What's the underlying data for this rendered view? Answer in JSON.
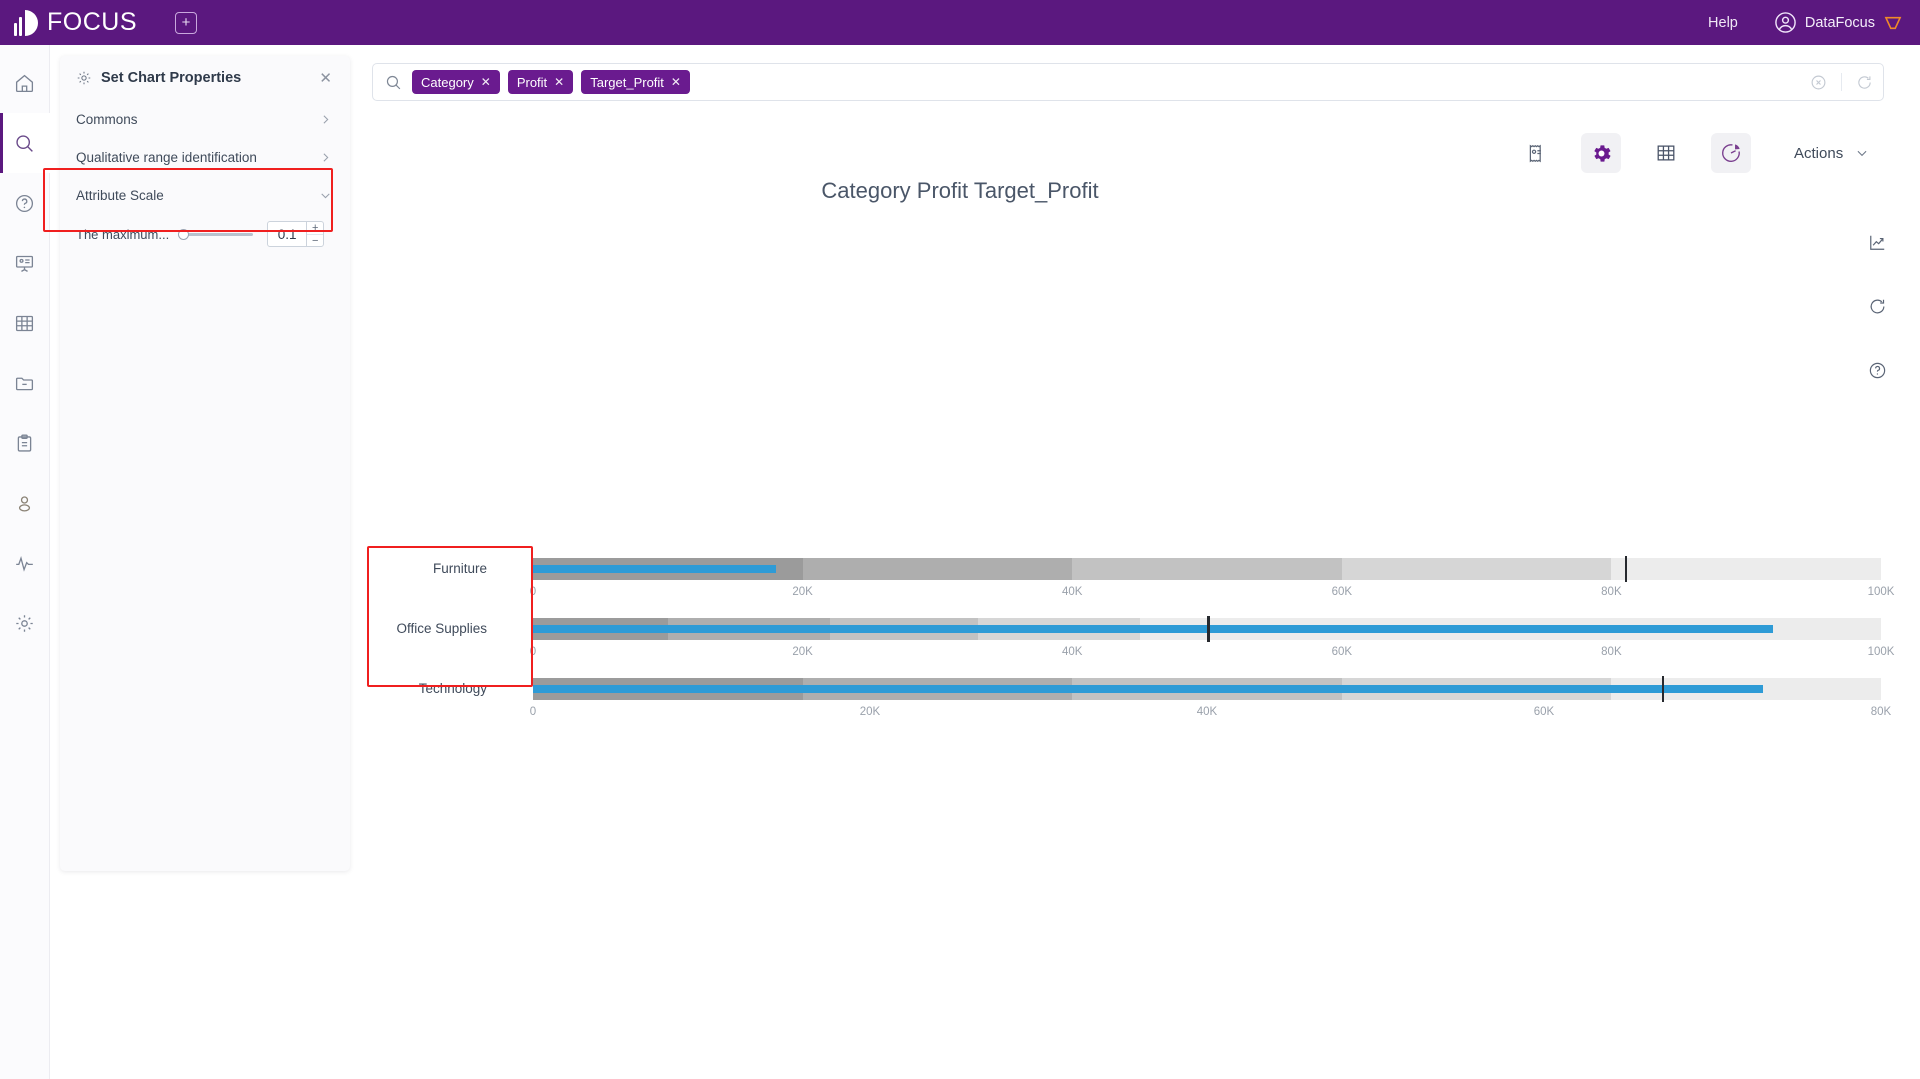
{
  "topbar": {
    "logo_text": "FOCUS",
    "add_tab_icon": "plus-square-icon",
    "help_label": "Help",
    "user_name": "DataFocus",
    "avatar_icon": "user-circle-icon",
    "brand_icon": "diamond-icon"
  },
  "rail": {
    "items": [
      {
        "name": "home",
        "icon": "home-icon",
        "active": false
      },
      {
        "name": "search",
        "icon": "search-icon",
        "active": true
      },
      {
        "name": "help",
        "icon": "question-circle-icon",
        "active": false
      },
      {
        "name": "dashboard",
        "icon": "presentation-icon",
        "active": false
      },
      {
        "name": "table",
        "icon": "grid-icon",
        "active": false
      },
      {
        "name": "folder",
        "icon": "folder-minus-icon",
        "active": false
      },
      {
        "name": "clipboard",
        "icon": "clipboard-icon",
        "active": false
      },
      {
        "name": "profile",
        "icon": "user-icon",
        "active": false
      },
      {
        "name": "monitor",
        "icon": "pulse-icon",
        "active": false
      },
      {
        "name": "settings",
        "icon": "gear-icon",
        "active": false
      }
    ]
  },
  "panel": {
    "gear_icon": "gear-icon",
    "title": "Set Chart Properties",
    "close_icon": "close-icon",
    "sections": [
      {
        "label": "Commons",
        "expanded": false,
        "chevron": "chevron-right-icon"
      },
      {
        "label": "Qualitative range identification",
        "expanded": false,
        "chevron": "chevron-right-icon"
      },
      {
        "label": "Attribute Scale",
        "expanded": true,
        "chevron": "chevron-down-icon"
      }
    ],
    "attribute_scale": {
      "field_label": "The maximum...",
      "value": "0.1",
      "slider_percent": 0,
      "increment_label": "+",
      "decrement_label": "−"
    },
    "highlight_color": "#f01f1f"
  },
  "search": {
    "icon": "search-icon",
    "chips": [
      {
        "label": "Category",
        "remove_icon": "close-icon"
      },
      {
        "label": "Profit",
        "remove_icon": "close-icon"
      },
      {
        "label": "Target_Profit",
        "remove_icon": "close-icon"
      }
    ],
    "clear_icon": "circle-x-icon",
    "refresh_icon": "refresh-icon"
  },
  "chart_tools": {
    "buttons": [
      {
        "name": "answer-icon",
        "active": false
      },
      {
        "name": "chart-settings-gear-icon",
        "active": true
      },
      {
        "name": "data-table-icon",
        "active": false
      },
      {
        "name": "chart-type-pie-icon",
        "active": true
      }
    ],
    "actions_label": "Actions",
    "actions_chevron": "chevron-down-icon"
  },
  "side_tools": [
    {
      "name": "trend-chart-icon"
    },
    {
      "name": "refresh-icon"
    },
    {
      "name": "help-circle-icon"
    }
  ],
  "chart_data": {
    "type": "bar",
    "subtype": "bullet",
    "title": "Category Profit Target_Profit",
    "xlabel": "",
    "ylabel": "",
    "categories": [
      "Furniture",
      "Office Supplies",
      "Technology"
    ],
    "series": [
      {
        "name": "Profit",
        "values": [
          18000,
          92000,
          73000
        ],
        "color": "#2e9bd6"
      },
      {
        "name": "Target_Profit",
        "values": [
          81000,
          50000,
          67000
        ],
        "color": "#26292e"
      }
    ],
    "rows": [
      {
        "category": "Furniture",
        "measure": 18000,
        "target": 81000,
        "axis_max": 100000,
        "axis_ticks": [
          0,
          20000,
          40000,
          60000,
          80000,
          100000
        ],
        "tick_labels": [
          "0",
          "20K",
          "40K",
          "60K",
          "80K",
          "100K"
        ],
        "bands": [
          {
            "to": 20000,
            "color": "#9b9b9b"
          },
          {
            "to": 40000,
            "color": "#aeaeae"
          },
          {
            "to": 60000,
            "color": "#c2c2c2"
          },
          {
            "to": 80000,
            "color": "#d6d6d6"
          },
          {
            "to": 100000,
            "color": "#ececec"
          }
        ]
      },
      {
        "category": "Office Supplies",
        "measure": 92000,
        "target": 50000,
        "axis_max": 100000,
        "axis_ticks": [
          0,
          20000,
          40000,
          60000,
          80000,
          100000
        ],
        "tick_labels": [
          "0",
          "20K",
          "40K",
          "60K",
          "80K",
          "100K"
        ],
        "bands": [
          {
            "to": 10000,
            "color": "#9b9b9b"
          },
          {
            "to": 22000,
            "color": "#aeaeae"
          },
          {
            "to": 33000,
            "color": "#c2c2c2"
          },
          {
            "to": 45000,
            "color": "#d6d6d6"
          },
          {
            "to": 100000,
            "color": "#ececec"
          }
        ]
      },
      {
        "category": "Technology",
        "measure": 73000,
        "target": 67000,
        "axis_max": 80000,
        "axis_ticks": [
          0,
          20000,
          40000,
          60000,
          80000
        ],
        "tick_labels": [
          "0",
          "20K",
          "40K",
          "60K",
          "80K"
        ],
        "bands": [
          {
            "to": 16000,
            "color": "#9b9b9b"
          },
          {
            "to": 32000,
            "color": "#aeaeae"
          },
          {
            "to": 48000,
            "color": "#c2c2c2"
          },
          {
            "to": 64000,
            "color": "#d6d6d6"
          },
          {
            "to": 80000,
            "color": "#ececec"
          }
        ]
      }
    ],
    "grid": false,
    "legend": "none",
    "measure_color": "#2e9bd6",
    "target_color": "#26292e"
  }
}
